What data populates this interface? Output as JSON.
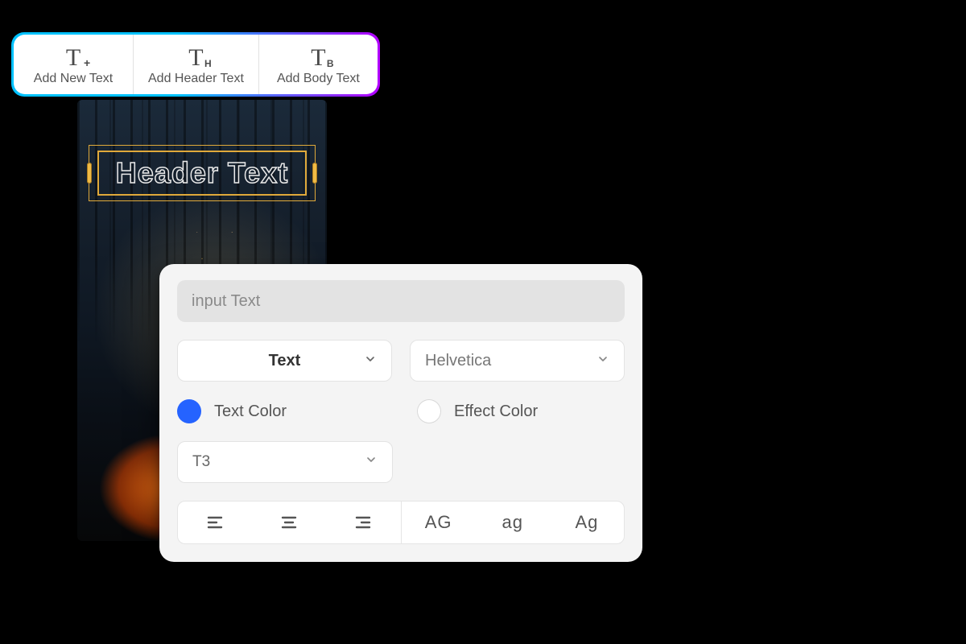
{
  "toolbar": {
    "add_new_label": "Add New Text",
    "add_header_label": "Add Header Text",
    "add_body_label": "Add Body Text"
  },
  "canvas": {
    "selected_text": "Header Text"
  },
  "panel": {
    "input_placeholder": "input Text",
    "input_value": "",
    "style_select": "Text",
    "font_select": "Helvetica",
    "text_color_label": "Text Color",
    "text_color_value": "#2563ff",
    "effect_color_label": "Effect Color",
    "effect_color_value": "#ffffff",
    "size_select": "T3",
    "case_upper": "AG",
    "case_lower": "ag",
    "case_title": "Ag"
  }
}
